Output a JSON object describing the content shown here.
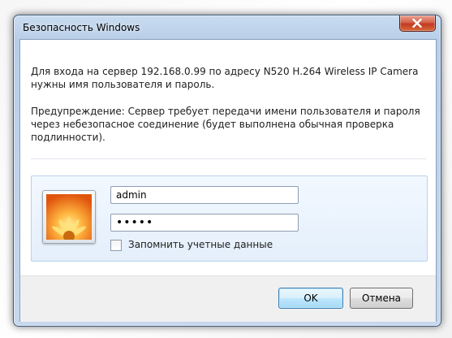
{
  "window": {
    "title": "Безопасность Windows",
    "close_glyph": "X"
  },
  "message": {
    "line1": "Для входа на сервер 192.168.0.99 по адресу N520 H.264 Wireless IP Camera нужны имя пользователя и пароль.",
    "warning": "Предупреждение: Сервер требует передачи имени пользователя и пароля через небезопасное соединение (будет выполнена обычная проверка подлинности)."
  },
  "credentials": {
    "username_value": "admin",
    "password_value": "•••••",
    "remember_label": "Запомнить учетные данные",
    "remember_checked": false,
    "avatar_icon": "flower-user-tile-icon"
  },
  "buttons": {
    "ok_label": "OK",
    "cancel_label": "Отмена"
  },
  "colors": {
    "close_button": "#c8452a",
    "ok_button": "#bee6fd",
    "credential_panel": "#e8f1fb"
  }
}
